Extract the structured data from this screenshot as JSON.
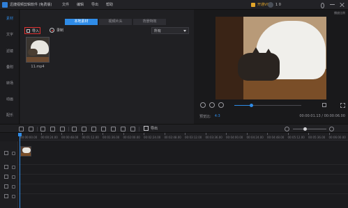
{
  "app": {
    "title": "迅捷视频剪辑软件 (免费版)",
    "menu": [
      "文件",
      "编辑",
      "导出",
      "帮助"
    ],
    "vip_label": "开通VIP",
    "user_name": "1 0"
  },
  "preview": {
    "label": "播放比例",
    "ratio_label": "预览比:",
    "ratio_value": "4:3",
    "timecode": "00:00:01.13 / 00:00:06.00",
    "progress": 0.25
  },
  "sidebar": {
    "items": [
      {
        "label": "素材",
        "active": true
      },
      {
        "label": "文字",
        "active": false
      },
      {
        "label": "滤镜",
        "active": false
      },
      {
        "label": "叠附",
        "active": false
      },
      {
        "label": "转场",
        "active": false
      },
      {
        "label": "动画",
        "active": false
      },
      {
        "label": "配乐",
        "active": false
      }
    ]
  },
  "media": {
    "tabs": [
      {
        "label": "本地素材",
        "active": true
      },
      {
        "label": "视频片头",
        "active": false
      },
      {
        "label": "背景特效",
        "active": false
      }
    ],
    "import_label": "导入",
    "record_label": "录制",
    "filter_value": "所有",
    "files": [
      {
        "name": "11.mp4"
      }
    ]
  },
  "toolbar": {
    "export_label": "导出",
    "zoom_level": 0.35
  },
  "timeline": {
    "ticks": [
      "00:00:00.00",
      "00:00:24.00",
      "00:00:48.00",
      "00:01:12.00",
      "00:01:36.00",
      "00:02:00.00",
      "00:02:24.00",
      "00:02:48.00",
      "00:03:12.00",
      "00:03:36.00",
      "00:04:00.00",
      "00:04:24.00",
      "00:04:48.00",
      "00:05:12.00",
      "00:05:36.00",
      "00:06:00.00"
    ]
  },
  "colors": {
    "accent": "#2f8ce8",
    "highlight": "#e03131",
    "vip": "#e2a52a"
  }
}
